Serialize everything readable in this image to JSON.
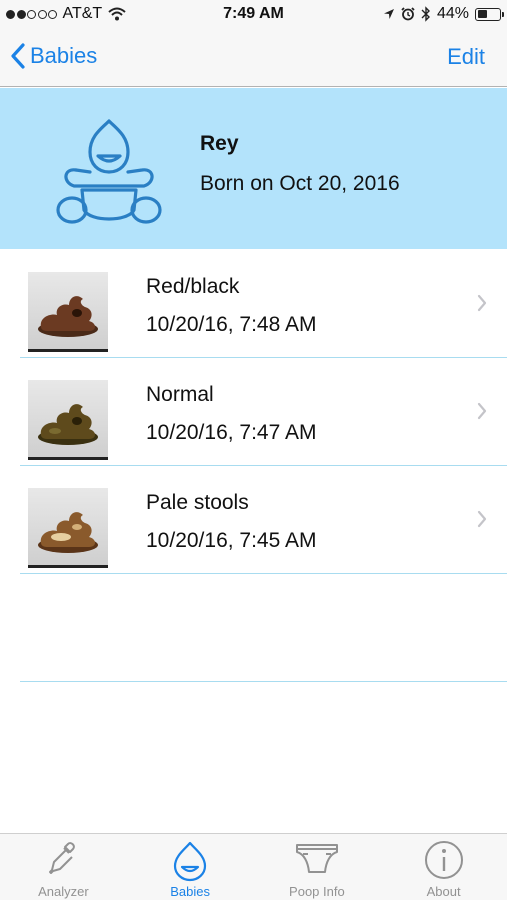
{
  "status_bar": {
    "carrier": "AT&T",
    "time": "7:49 AM",
    "battery": "44%",
    "battery_level": 0.44
  },
  "nav": {
    "back_label": "Babies",
    "edit_label": "Edit"
  },
  "baby": {
    "name": "Rey",
    "born": "Born on Oct 20, 2016"
  },
  "entries": [
    {
      "title": "Red/black",
      "time": "10/20/16, 7:48 AM",
      "color": "#6b3a22"
    },
    {
      "title": "Normal",
      "time": "10/20/16, 7:47 AM",
      "color": "#5e4a1c"
    },
    {
      "title": "Pale stools",
      "time": "10/20/16, 7:45 AM",
      "color": "#8a5a2c"
    }
  ],
  "tabs": [
    {
      "label": "Analyzer",
      "icon": "dropper-icon",
      "active": false
    },
    {
      "label": "Babies",
      "icon": "baby-drop-icon",
      "active": true
    },
    {
      "label": "Poop Info",
      "icon": "diaper-icon",
      "active": false
    },
    {
      "label": "About",
      "icon": "info-icon",
      "active": false
    }
  ],
  "colors": {
    "accent": "#1b82e6",
    "header_bg": "#b3e3fb",
    "separator": "#a8dcf0"
  }
}
